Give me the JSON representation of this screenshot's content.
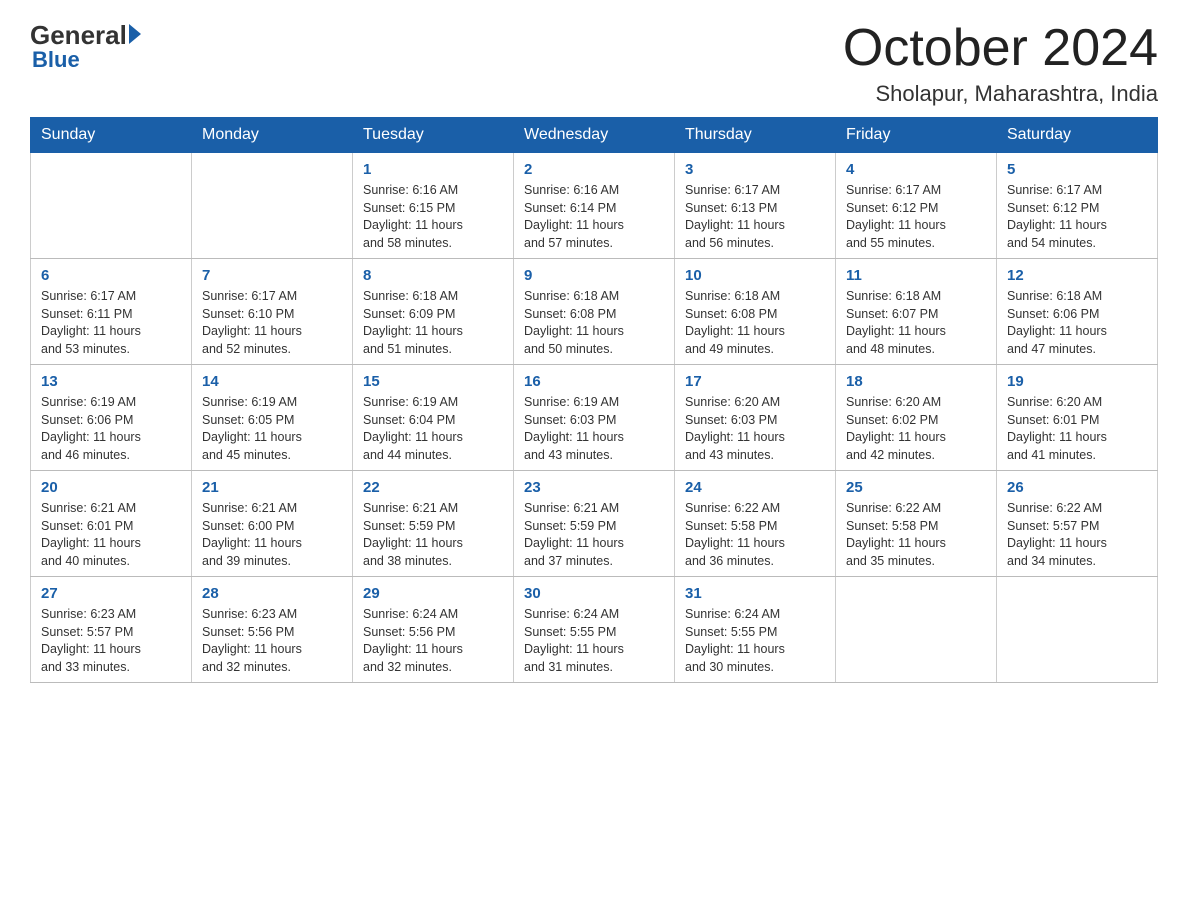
{
  "logo": {
    "general": "General",
    "blue": "Blue"
  },
  "title": "October 2024",
  "location": "Sholapur, Maharashtra, India",
  "days_of_week": [
    "Sunday",
    "Monday",
    "Tuesday",
    "Wednesday",
    "Thursday",
    "Friday",
    "Saturday"
  ],
  "weeks": [
    [
      {
        "day": "",
        "info": ""
      },
      {
        "day": "",
        "info": ""
      },
      {
        "day": "1",
        "info": "Sunrise: 6:16 AM\nSunset: 6:15 PM\nDaylight: 11 hours\nand 58 minutes."
      },
      {
        "day": "2",
        "info": "Sunrise: 6:16 AM\nSunset: 6:14 PM\nDaylight: 11 hours\nand 57 minutes."
      },
      {
        "day": "3",
        "info": "Sunrise: 6:17 AM\nSunset: 6:13 PM\nDaylight: 11 hours\nand 56 minutes."
      },
      {
        "day": "4",
        "info": "Sunrise: 6:17 AM\nSunset: 6:12 PM\nDaylight: 11 hours\nand 55 minutes."
      },
      {
        "day": "5",
        "info": "Sunrise: 6:17 AM\nSunset: 6:12 PM\nDaylight: 11 hours\nand 54 minutes."
      }
    ],
    [
      {
        "day": "6",
        "info": "Sunrise: 6:17 AM\nSunset: 6:11 PM\nDaylight: 11 hours\nand 53 minutes."
      },
      {
        "day": "7",
        "info": "Sunrise: 6:17 AM\nSunset: 6:10 PM\nDaylight: 11 hours\nand 52 minutes."
      },
      {
        "day": "8",
        "info": "Sunrise: 6:18 AM\nSunset: 6:09 PM\nDaylight: 11 hours\nand 51 minutes."
      },
      {
        "day": "9",
        "info": "Sunrise: 6:18 AM\nSunset: 6:08 PM\nDaylight: 11 hours\nand 50 minutes."
      },
      {
        "day": "10",
        "info": "Sunrise: 6:18 AM\nSunset: 6:08 PM\nDaylight: 11 hours\nand 49 minutes."
      },
      {
        "day": "11",
        "info": "Sunrise: 6:18 AM\nSunset: 6:07 PM\nDaylight: 11 hours\nand 48 minutes."
      },
      {
        "day": "12",
        "info": "Sunrise: 6:18 AM\nSunset: 6:06 PM\nDaylight: 11 hours\nand 47 minutes."
      }
    ],
    [
      {
        "day": "13",
        "info": "Sunrise: 6:19 AM\nSunset: 6:06 PM\nDaylight: 11 hours\nand 46 minutes."
      },
      {
        "day": "14",
        "info": "Sunrise: 6:19 AM\nSunset: 6:05 PM\nDaylight: 11 hours\nand 45 minutes."
      },
      {
        "day": "15",
        "info": "Sunrise: 6:19 AM\nSunset: 6:04 PM\nDaylight: 11 hours\nand 44 minutes."
      },
      {
        "day": "16",
        "info": "Sunrise: 6:19 AM\nSunset: 6:03 PM\nDaylight: 11 hours\nand 43 minutes."
      },
      {
        "day": "17",
        "info": "Sunrise: 6:20 AM\nSunset: 6:03 PM\nDaylight: 11 hours\nand 43 minutes."
      },
      {
        "day": "18",
        "info": "Sunrise: 6:20 AM\nSunset: 6:02 PM\nDaylight: 11 hours\nand 42 minutes."
      },
      {
        "day": "19",
        "info": "Sunrise: 6:20 AM\nSunset: 6:01 PM\nDaylight: 11 hours\nand 41 minutes."
      }
    ],
    [
      {
        "day": "20",
        "info": "Sunrise: 6:21 AM\nSunset: 6:01 PM\nDaylight: 11 hours\nand 40 minutes."
      },
      {
        "day": "21",
        "info": "Sunrise: 6:21 AM\nSunset: 6:00 PM\nDaylight: 11 hours\nand 39 minutes."
      },
      {
        "day": "22",
        "info": "Sunrise: 6:21 AM\nSunset: 5:59 PM\nDaylight: 11 hours\nand 38 minutes."
      },
      {
        "day": "23",
        "info": "Sunrise: 6:21 AM\nSunset: 5:59 PM\nDaylight: 11 hours\nand 37 minutes."
      },
      {
        "day": "24",
        "info": "Sunrise: 6:22 AM\nSunset: 5:58 PM\nDaylight: 11 hours\nand 36 minutes."
      },
      {
        "day": "25",
        "info": "Sunrise: 6:22 AM\nSunset: 5:58 PM\nDaylight: 11 hours\nand 35 minutes."
      },
      {
        "day": "26",
        "info": "Sunrise: 6:22 AM\nSunset: 5:57 PM\nDaylight: 11 hours\nand 34 minutes."
      }
    ],
    [
      {
        "day": "27",
        "info": "Sunrise: 6:23 AM\nSunset: 5:57 PM\nDaylight: 11 hours\nand 33 minutes."
      },
      {
        "day": "28",
        "info": "Sunrise: 6:23 AM\nSunset: 5:56 PM\nDaylight: 11 hours\nand 32 minutes."
      },
      {
        "day": "29",
        "info": "Sunrise: 6:24 AM\nSunset: 5:56 PM\nDaylight: 11 hours\nand 32 minutes."
      },
      {
        "day": "30",
        "info": "Sunrise: 6:24 AM\nSunset: 5:55 PM\nDaylight: 11 hours\nand 31 minutes."
      },
      {
        "day": "31",
        "info": "Sunrise: 6:24 AM\nSunset: 5:55 PM\nDaylight: 11 hours\nand 30 minutes."
      },
      {
        "day": "",
        "info": ""
      },
      {
        "day": "",
        "info": ""
      }
    ]
  ]
}
